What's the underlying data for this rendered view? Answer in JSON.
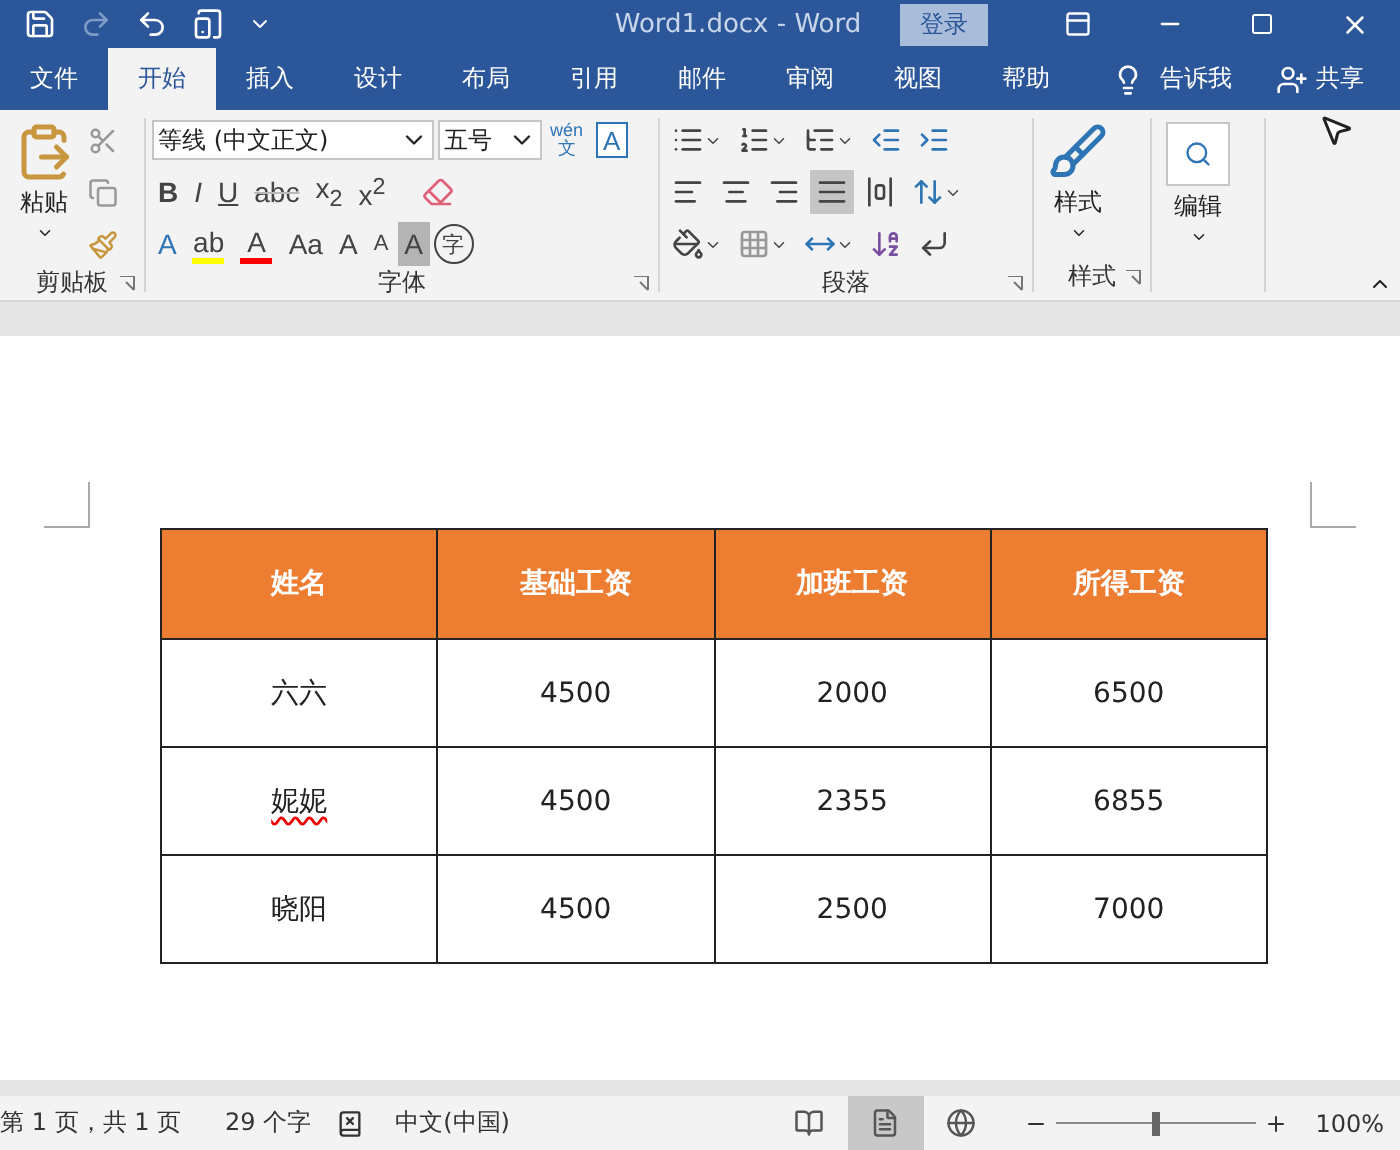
{
  "quick_access": [
    {
      "kind": "save",
      "disabled": false
    },
    {
      "kind": "redo",
      "disabled": true
    },
    {
      "kind": "undo",
      "disabled": false
    },
    {
      "kind": "touch",
      "disabled": false
    },
    {
      "kind": "customize",
      "disabled": false
    }
  ],
  "title_bar": {
    "title": "Word1.docx  -  Word",
    "login": "登录"
  },
  "tabs": [
    {
      "label": "文件",
      "selected": false
    },
    {
      "label": "开始",
      "selected": true
    },
    {
      "label": "插入",
      "selected": false
    },
    {
      "label": "设计",
      "selected": false
    },
    {
      "label": "布局",
      "selected": false
    },
    {
      "label": "引用",
      "selected": false
    },
    {
      "label": "邮件",
      "selected": false
    },
    {
      "label": "审阅",
      "selected": false
    },
    {
      "label": "视图",
      "selected": false
    },
    {
      "label": "帮助",
      "selected": false
    }
  ],
  "tell_me": "告诉我",
  "share": "共享",
  "clipboard": {
    "label": "剪贴板",
    "paste": "粘贴"
  },
  "font": {
    "label": "字体",
    "font_name": "等线 (中文正文)",
    "font_size": "五号",
    "phonetic_top": "wén",
    "phonetic_bottom": "文",
    "border_char": "A",
    "format_buttons": [
      {
        "kind": "bold",
        "text": "B"
      },
      {
        "kind": "italic",
        "text": "I"
      },
      {
        "kind": "underline",
        "text": "U"
      },
      {
        "kind": "strike",
        "text": "abc"
      },
      {
        "kind": "plain",
        "text": "x$_{2}$"
      },
      {
        "kind": "plain",
        "text": "x$^{2}$"
      }
    ],
    "effect_buttons": [
      {
        "kind": "outline",
        "text": "A"
      },
      {
        "kind": "colorbar",
        "text": "ab",
        "color": "#ffff00"
      },
      {
        "kind": "colorbar",
        "text": "A",
        "color": "#ff0000"
      },
      {
        "kind": "dropdown",
        "text": "Aa"
      },
      {
        "kind": "grow",
        "text": "A"
      },
      {
        "kind": "shrink",
        "text": "A"
      },
      {
        "kind": "shaded",
        "text": "A"
      },
      {
        "kind": "circled",
        "text": "字"
      }
    ]
  },
  "paragraph": {
    "label": "段落",
    "alignments": [
      {
        "kind": "left",
        "selected": false
      },
      {
        "kind": "center",
        "selected": false
      },
      {
        "kind": "right",
        "selected": false
      },
      {
        "kind": "justify",
        "selected": true
      },
      {
        "kind": "distributed",
        "selected": false
      }
    ]
  },
  "styles": {
    "label": "样式",
    "button": "样式"
  },
  "editing": {
    "button": "编辑"
  },
  "table": {
    "columns": [
      "姓名",
      "基础工资",
      "加班工资",
      "所得工资"
    ],
    "rows": [
      [
        {
          "text": "六六",
          "misspelled": false
        },
        {
          "text": "4500",
          "misspelled": false
        },
        {
          "text": "2000",
          "misspelled": false
        },
        {
          "text": "6500",
          "misspelled": false
        }
      ],
      [
        {
          "text": "妮妮",
          "misspelled": true
        },
        {
          "text": "4500",
          "misspelled": false
        },
        {
          "text": "2355",
          "misspelled": false
        },
        {
          "text": "6855",
          "misspelled": false
        }
      ],
      [
        {
          "text": "晓阳",
          "misspelled": false
        },
        {
          "text": "4500",
          "misspelled": false
        },
        {
          "text": "2500",
          "misspelled": false
        },
        {
          "text": "7000",
          "misspelled": false
        }
      ]
    ]
  },
  "status_bar": {
    "page": "第 1 页，共 1 页",
    "words": "29 个字",
    "language": "中文(中国)",
    "views": [
      {
        "kind": "read",
        "selected": false
      },
      {
        "kind": "print",
        "selected": true
      },
      {
        "kind": "web",
        "selected": false
      }
    ],
    "zoom": {
      "level": 0.5,
      "reading": "100%"
    }
  }
}
